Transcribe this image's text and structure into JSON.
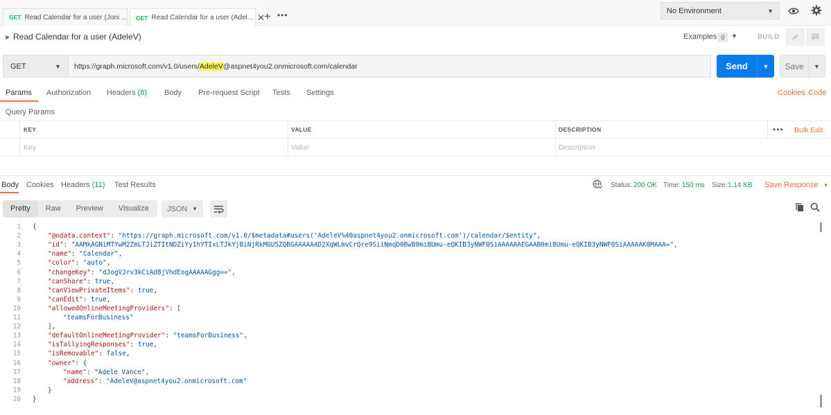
{
  "tabs": [
    {
      "method": "GET",
      "label": "Read Calendar for a user (Joni ..."
    },
    {
      "method": "GET",
      "label": "Read Calendar for a user (Adel...",
      "close": "✕"
    }
  ],
  "tab_add": "+",
  "tab_more": "•••",
  "environment": {
    "selected": "No Environment"
  },
  "request": {
    "title": "Read Calendar for a user (AdeleV)",
    "examples_label": "Examples",
    "examples_count": "0",
    "build_label": "BUILD",
    "method": "GET",
    "url_prefix": "https://graph.microsoft.com/v1.0/users/",
    "url_highlight": "AdeleV",
    "url_suffix": "@aspnet4you2.onmicrosoft.com/calendar",
    "send_label": "Send",
    "save_label": "Save"
  },
  "request_tabs": {
    "params": "Params",
    "authorization": "Authorization",
    "headers": "Headers",
    "headers_count": "(8)",
    "body": "Body",
    "prerequest": "Pre-request Script",
    "tests": "Tests",
    "settings": "Settings",
    "cookies": "Cookies",
    "code": "Code"
  },
  "query_params": {
    "label": "Query Params",
    "columns": [
      "KEY",
      "VALUE",
      "DESCRIPTION"
    ],
    "placeholders": [
      "Key",
      "Value",
      "Description"
    ],
    "more": "•••",
    "bulk_edit": "Bulk Edit"
  },
  "response": {
    "tabs": {
      "body": "Body",
      "cookies": "Cookies",
      "headers": "Headers",
      "headers_count": "(11)",
      "test_results": "Test Results"
    },
    "status_label": "Status:",
    "status_value": "200 OK",
    "time_label": "Time:",
    "time_value": "150 ms",
    "size_label": "Size:",
    "size_value": "1.14 KB",
    "save_response": "Save Response",
    "views": [
      "Pretty",
      "Raw",
      "Preview",
      "Visualize"
    ],
    "format": "JSON"
  },
  "code_lines": [
    {
      "n": "1",
      "indent": 0,
      "parts": [
        [
          "punc",
          "{"
        ]
      ]
    },
    {
      "n": "2",
      "indent": 1,
      "parts": [
        [
          "key",
          "\"@odata.context\""
        ],
        [
          "punc",
          ": "
        ],
        [
          "str",
          "\"https://graph.microsoft.com/v1.0/$metadata#users('AdeleV%40aspnet4you2.onmicrosoft.com')/calendar/$entity\""
        ],
        [
          "punc",
          ","
        ]
      ]
    },
    {
      "n": "3",
      "indent": 1,
      "parts": [
        [
          "key",
          "\"id\""
        ],
        [
          "punc",
          ": "
        ],
        [
          "str",
          "\"AAMkAGNiMTYwM2ZmLTJiZTItNDZiYy1hYTIxLTJkYjBiNjRkMGU5ZQBGAAAAAAD2XqWLmvCrQre9SiiNmqD0BwB0miBUmu-eQKIB3yNWF0SiAAAAAAEGAAB0miBUmu-eQKIB3yNWF0SiAAAAAK0MAAA=\""
        ],
        [
          "punc",
          ","
        ]
      ]
    },
    {
      "n": "4",
      "indent": 1,
      "parts": [
        [
          "key",
          "\"name\""
        ],
        [
          "punc",
          ": "
        ],
        [
          "str",
          "\"Calendar\""
        ],
        [
          "punc",
          ","
        ]
      ]
    },
    {
      "n": "5",
      "indent": 1,
      "parts": [
        [
          "key",
          "\"color\""
        ],
        [
          "punc",
          ": "
        ],
        [
          "str",
          "\"auto\""
        ],
        [
          "punc",
          ","
        ]
      ]
    },
    {
      "n": "6",
      "indent": 1,
      "parts": [
        [
          "key",
          "\"changeKey\""
        ],
        [
          "punc",
          ": "
        ],
        [
          "str",
          "\"dJogVJrv3kCiAd8jVhdEogAAAAAGgg==\""
        ],
        [
          "punc",
          ","
        ]
      ]
    },
    {
      "n": "7",
      "indent": 1,
      "parts": [
        [
          "key",
          "\"canShare\""
        ],
        [
          "punc",
          ": "
        ],
        [
          "lit",
          "true"
        ],
        [
          "punc",
          ","
        ]
      ]
    },
    {
      "n": "8",
      "indent": 1,
      "parts": [
        [
          "key",
          "\"canViewPrivateItems\""
        ],
        [
          "punc",
          ": "
        ],
        [
          "lit",
          "true"
        ],
        [
          "punc",
          ","
        ]
      ]
    },
    {
      "n": "9",
      "indent": 1,
      "parts": [
        [
          "key",
          "\"canEdit\""
        ],
        [
          "punc",
          ": "
        ],
        [
          "lit",
          "true"
        ],
        [
          "punc",
          ","
        ]
      ]
    },
    {
      "n": "10",
      "indent": 1,
      "parts": [
        [
          "key",
          "\"allowedOnlineMeetingProviders\""
        ],
        [
          "punc",
          ": ["
        ]
      ]
    },
    {
      "n": "11",
      "indent": 2,
      "parts": [
        [
          "str",
          "\"teamsForBusiness\""
        ]
      ]
    },
    {
      "n": "12",
      "indent": 1,
      "parts": [
        [
          "punc",
          "],"
        ]
      ]
    },
    {
      "n": "13",
      "indent": 1,
      "parts": [
        [
          "key",
          "\"defaultOnlineMeetingProvider\""
        ],
        [
          "punc",
          ": "
        ],
        [
          "str",
          "\"teamsForBusiness\""
        ],
        [
          "punc",
          ","
        ]
      ]
    },
    {
      "n": "14",
      "indent": 1,
      "parts": [
        [
          "key",
          "\"isTallyingResponses\""
        ],
        [
          "punc",
          ": "
        ],
        [
          "lit",
          "true"
        ],
        [
          "punc",
          ","
        ]
      ]
    },
    {
      "n": "15",
      "indent": 1,
      "parts": [
        [
          "key",
          "\"isRemovable\""
        ],
        [
          "punc",
          ": "
        ],
        [
          "lit",
          "false"
        ],
        [
          "punc",
          ","
        ]
      ]
    },
    {
      "n": "16",
      "indent": 1,
      "parts": [
        [
          "key",
          "\"owner\""
        ],
        [
          "punc",
          ": {"
        ]
      ]
    },
    {
      "n": "17",
      "indent": 2,
      "parts": [
        [
          "key",
          "\"name\""
        ],
        [
          "punc",
          ": "
        ],
        [
          "str",
          "\"Adele Vance\""
        ],
        [
          "punc",
          ","
        ]
      ]
    },
    {
      "n": "18",
      "indent": 2,
      "parts": [
        [
          "key",
          "\"address\""
        ],
        [
          "punc",
          ": "
        ],
        [
          "str",
          "\"AdeleV@aspnet4you2.onmicrosoft.com\""
        ]
      ]
    },
    {
      "n": "19",
      "indent": 1,
      "parts": [
        [
          "punc",
          "}"
        ]
      ]
    },
    {
      "n": "20",
      "indent": 0,
      "parts": [
        [
          "punc",
          "}"
        ]
      ]
    }
  ],
  "colors": {
    "accent": "#f26b3a",
    "send": "#097bed",
    "success": "#0c9e4a",
    "method": "#0cbb52",
    "highlight": "#f7f24f"
  }
}
